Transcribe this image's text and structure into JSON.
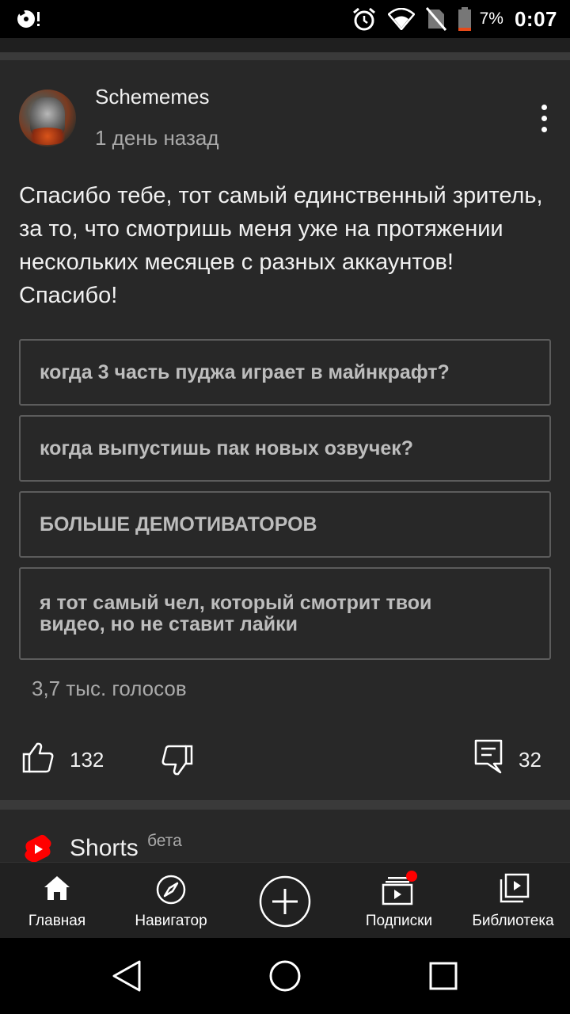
{
  "status_bar": {
    "battery_percent": "7%",
    "time": "0:07"
  },
  "post": {
    "author": "Schememes",
    "time_ago": "1 день назад",
    "text": "Спасибо тебе, тот самый единственный зритель, за то, что смотришь меня уже на протяжении нескольких месяцев с разных аккаунтов! Спасибо!",
    "poll_options": [
      "когда 3 часть пуджа играет в майнкрафт?",
      "когда выпустишь пак новых озвучек?",
      "БОЛЬШЕ ДЕМОТИВАТОРОВ",
      "я тот самый чел, который смотрит твои видео, но не ставит лайки"
    ],
    "votes": "3,7 тыс. голосов",
    "likes": "132",
    "comments": "32"
  },
  "shorts": {
    "title": "Shorts",
    "badge": "бета"
  },
  "bottom_nav": {
    "items": [
      {
        "label": "Главная"
      },
      {
        "label": "Навигатор"
      },
      {
        "label": "Подписки"
      },
      {
        "label": "Библиотека"
      }
    ]
  },
  "colors": {
    "background": "#282828",
    "accent_red": "#ff0000",
    "secondary_text": "#aaaaaa"
  }
}
